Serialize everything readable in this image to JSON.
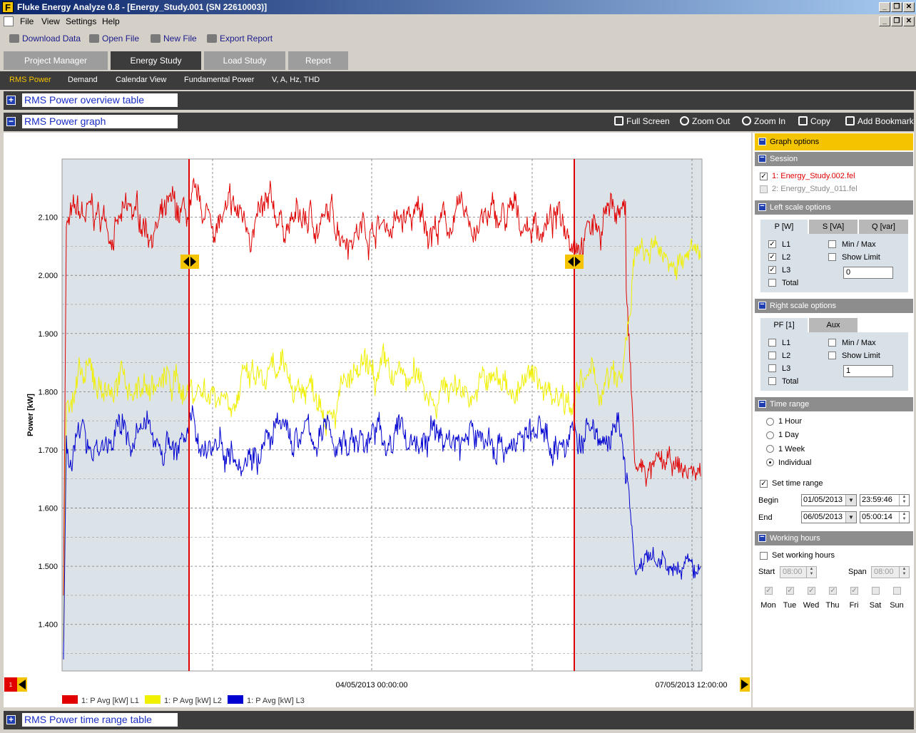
{
  "window": {
    "title": "Fluke Energy Analyze 0.8 - [Energy_Study.001 (SN 22610003)]",
    "logo_letter": "F"
  },
  "menu": [
    "File",
    "View",
    "Settings",
    "Help"
  ],
  "toolbar": {
    "download_label": "Download Data",
    "open_label": "Open File",
    "new_label": "New File",
    "export_label": "Export Report"
  },
  "tabs": [
    "Project Manager",
    "Energy Study",
    "Load Study",
    "Report"
  ],
  "active_tab": "Energy Study",
  "subnav": [
    "RMS Power",
    "Demand",
    "Calendar View",
    "Fundamental Power",
    "V, A, Hz, THD"
  ],
  "active_subnav": "RMS Power",
  "sections": {
    "overview_title": "RMS Power overview table",
    "graph_title": "RMS Power graph",
    "time_range_table_title": "RMS Power time range table"
  },
  "graph_tools": {
    "full_screen": "Full Screen",
    "zoom_out": "Zoom Out",
    "zoom_in": "Zoom In",
    "copy": "Copy",
    "add_bookmark": "Add Bookmark"
  },
  "chart_data": {
    "type": "line",
    "ylabel": "Power [kW]",
    "ylim": [
      1.32,
      2.2
    ],
    "yticks": [
      "2.100",
      "2.000",
      "1.900",
      "1.800",
      "1.700",
      "1.600",
      "1.500",
      "1.400"
    ],
    "ytick_values": [
      2.1,
      2.0,
      1.9,
      1.8,
      1.7,
      1.6,
      1.5,
      1.4
    ],
    "x_labels": [
      "04/05/2013 00:00:00",
      "07/05/2013 12:00:00"
    ],
    "cursor_marker_label": "1",
    "grid": true,
    "legend_position": "bottom-left",
    "series": [
      {
        "name": "1: P Avg [kW] L1",
        "color": "#e00000",
        "mean": 2.09,
        "end_level": 1.66
      },
      {
        "name": "1: P Avg [kW] L2",
        "color": "#f0f000",
        "mean": 1.81,
        "end_level": 2.03
      },
      {
        "name": "1: P Avg [kW] L3",
        "color": "#0000d0",
        "mean": 1.72,
        "end_level": 1.49
      }
    ]
  },
  "panel": {
    "graph_options": "Graph options",
    "session": {
      "header": "Session",
      "items": [
        {
          "label": "1: Energy_Study.002.fel",
          "checked": true
        },
        {
          "label": "2: Energy_Study_011.fel",
          "checked": false
        }
      ]
    },
    "left_scale": {
      "header": "Left scale options",
      "tabs": [
        "P [W]",
        "S [VA]",
        "Q [var]"
      ],
      "lines": [
        {
          "label": "L1",
          "checked": true
        },
        {
          "label": "L2",
          "checked": true
        },
        {
          "label": "L3",
          "checked": true
        },
        {
          "label": "Total",
          "checked": false
        }
      ],
      "min_max": "Min / Max",
      "show_limit": "Show Limit",
      "limit_value": "0"
    },
    "right_scale": {
      "header": "Right scale options",
      "tabs": [
        "PF [1]",
        "Aux"
      ],
      "lines": [
        {
          "label": "L1",
          "checked": false
        },
        {
          "label": "L2",
          "checked": false
        },
        {
          "label": "L3",
          "checked": false
        },
        {
          "label": "Total",
          "checked": false
        }
      ],
      "min_max": "Min / Max",
      "show_limit": "Show Limit",
      "limit_value": "1"
    },
    "time_range": {
      "header": "Time range",
      "options": [
        "1 Hour",
        "1 Day",
        "1 Week",
        "Individual"
      ],
      "selected": "Individual",
      "set_time_range": "Set time range",
      "begin_label": "Begin",
      "begin_date": "01/05/2013",
      "begin_time": "23:59:46",
      "end_label": "End",
      "end_date": "06/05/2013",
      "end_time": "05:00:14"
    },
    "working_hours": {
      "header": "Working hours",
      "set_working_hours": "Set working hours",
      "start_label": "Start",
      "start_value": "08:00",
      "span_label": "Span",
      "span_value": "08:00",
      "days": [
        {
          "label": "Mon",
          "checked": true
        },
        {
          "label": "Tue",
          "checked": true
        },
        {
          "label": "Wed",
          "checked": true
        },
        {
          "label": "Thu",
          "checked": true
        },
        {
          "label": "Fri",
          "checked": true
        },
        {
          "label": "Sat",
          "checked": false
        },
        {
          "label": "Sun",
          "checked": false
        }
      ]
    }
  }
}
